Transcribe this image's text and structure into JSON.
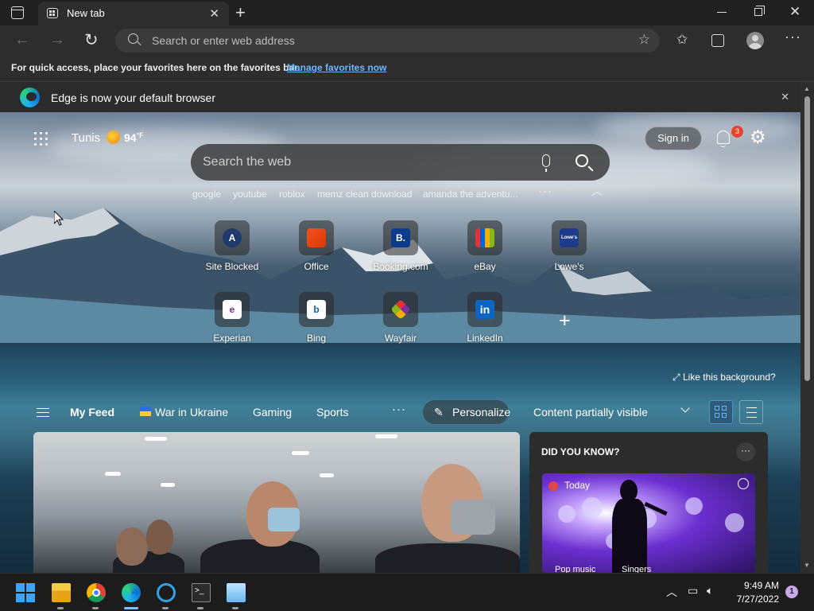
{
  "window": {
    "tab_title": "New tab"
  },
  "toolbar": {
    "address_placeholder": "Search or enter web address"
  },
  "favorites_bar": {
    "text": "For quick access, place your favorites here on the favorites bar.",
    "link": "Manage favorites now"
  },
  "banner": {
    "text": "Edge is now your default browser"
  },
  "weather": {
    "city": "Tunis",
    "temp": "94",
    "unit": "°F",
    "icon": "sun-icon"
  },
  "header": {
    "signin_label": "Sign in",
    "notification_count": "3"
  },
  "search": {
    "placeholder": "Search the web",
    "suggestions": [
      "google",
      "youtube",
      "roblox",
      "memz clean download",
      "amanda the adventu..."
    ]
  },
  "quick_links": [
    {
      "label": "Site Blocked",
      "mark": "A",
      "color": "#1f3b6e"
    },
    {
      "label": "Office",
      "mark": "",
      "color": "#d83b01"
    },
    {
      "label": "Booking.com",
      "mark": "B.",
      "color": "#0c3b8c"
    },
    {
      "label": "eBay",
      "mark": "",
      "color": "#e53238"
    },
    {
      "label": "Lowe's",
      "mark": "Lowe's",
      "color": "#1e3a8a"
    },
    {
      "label": "Experian",
      "mark": "e",
      "color": "#ffffff"
    },
    {
      "label": "Bing",
      "mark": "b",
      "color": "#ffffff"
    },
    {
      "label": "Wayfair",
      "mark": "",
      "color": "#7b2fa0"
    },
    {
      "label": "LinkedIn",
      "mark": "in",
      "color": "#0a66c2"
    }
  ],
  "background": {
    "like_label": "Like this background?"
  },
  "feed_nav": {
    "my_feed": "My Feed",
    "war": "War in Ukraine",
    "gaming": "Gaming",
    "sports": "Sports",
    "personalize": "Personalize",
    "content_visibility": "Content partially visible"
  },
  "did_you_know": {
    "title": "DID YOU KNOW?",
    "source": "Today",
    "tags": [
      "Pop music",
      "Singers"
    ]
  },
  "taskbar": {
    "time": "9:49 AM",
    "date": "7/27/2022",
    "notification_count": "1"
  }
}
